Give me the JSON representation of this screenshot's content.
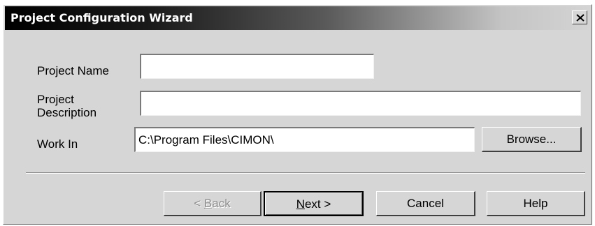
{
  "window": {
    "title": "Project Configuration Wizard",
    "close_glyph": "✕"
  },
  "form": {
    "project_name": {
      "label": "Project Name",
      "value": ""
    },
    "project_description": {
      "label_line1": "Project",
      "label_line2": "Description",
      "value": ""
    },
    "work_in": {
      "label": "Work In",
      "value": "C:\\Program Files\\CIMON\\"
    },
    "browse_label": "Browse..."
  },
  "buttons": {
    "back": {
      "prefix": "< ",
      "mnemonic": "B",
      "rest": "ack"
    },
    "next": {
      "mnemonic": "N",
      "rest": "ext >"
    },
    "cancel": "Cancel",
    "help": "Help"
  },
  "icons": {
    "close": "close-icon"
  }
}
